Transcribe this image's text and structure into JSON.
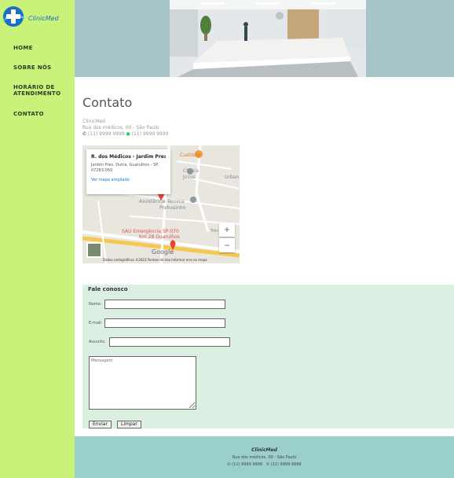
{
  "brand": {
    "name": "ClinicMed"
  },
  "nav": {
    "items": [
      {
        "label": "HOME"
      },
      {
        "label": "SOBRE NÓS"
      },
      {
        "label": "HORÁRIO DE ATENDIMENTO"
      },
      {
        "label": "CONTATO"
      }
    ]
  },
  "page": {
    "title": "Contato"
  },
  "contact": {
    "name": "ClinicMed",
    "address": "Rua dos médicos, 00 - São Paulo",
    "phone": "(11) 9999 9999",
    "whatsapp": "(11) 9999 9999"
  },
  "map": {
    "place_title": "R. dos Médicos - Jardim Pres...",
    "place_address": "Jardim Pres. Dutra, Guarulhos - SP, 07263-050",
    "view_larger": "Ver mapa ampliado",
    "zoom_in": "+",
    "zoom_out": "−",
    "brand": "Google",
    "footer": "Dados cartográficos ©2023   Termos de Uso   Informar erro no mapa",
    "labels": {
      "custodio": "Custódio",
      "clinica": "Clínica",
      "jesus": "Jesus",
      "urban": "Urban",
      "assist": "Assistência Técnica",
      "prehusinho": "Prehusinho",
      "sau": "SAU Emergência SP-070",
      "km": "Km 28 Guarulhos",
      "tres": "Três"
    },
    "colors": {
      "land": "#e9e6df",
      "highway": "#f5c850",
      "pin": "#ea4335"
    }
  },
  "form": {
    "title": "Fale conosco",
    "name_label": "Nome:",
    "email_label": "E-mail:",
    "subject_label": "Assunto:",
    "message_placeholder": "Mensagem",
    "send_label": "Enviar",
    "clear_label": "Limpar"
  },
  "footer": {
    "name": "ClinicMed",
    "address": "Rua dos médicos, 00 - São Paulo",
    "phone": "(11) 9999 9999",
    "whatsapp": "(11) 9999 9999"
  },
  "colors": {
    "sidebar": "#c8f27a",
    "header": "#a7c4c8",
    "form_bg": "#dcefe3",
    "footer_bg": "#9bcfcc",
    "logo_blue": "#1e6fbf"
  }
}
